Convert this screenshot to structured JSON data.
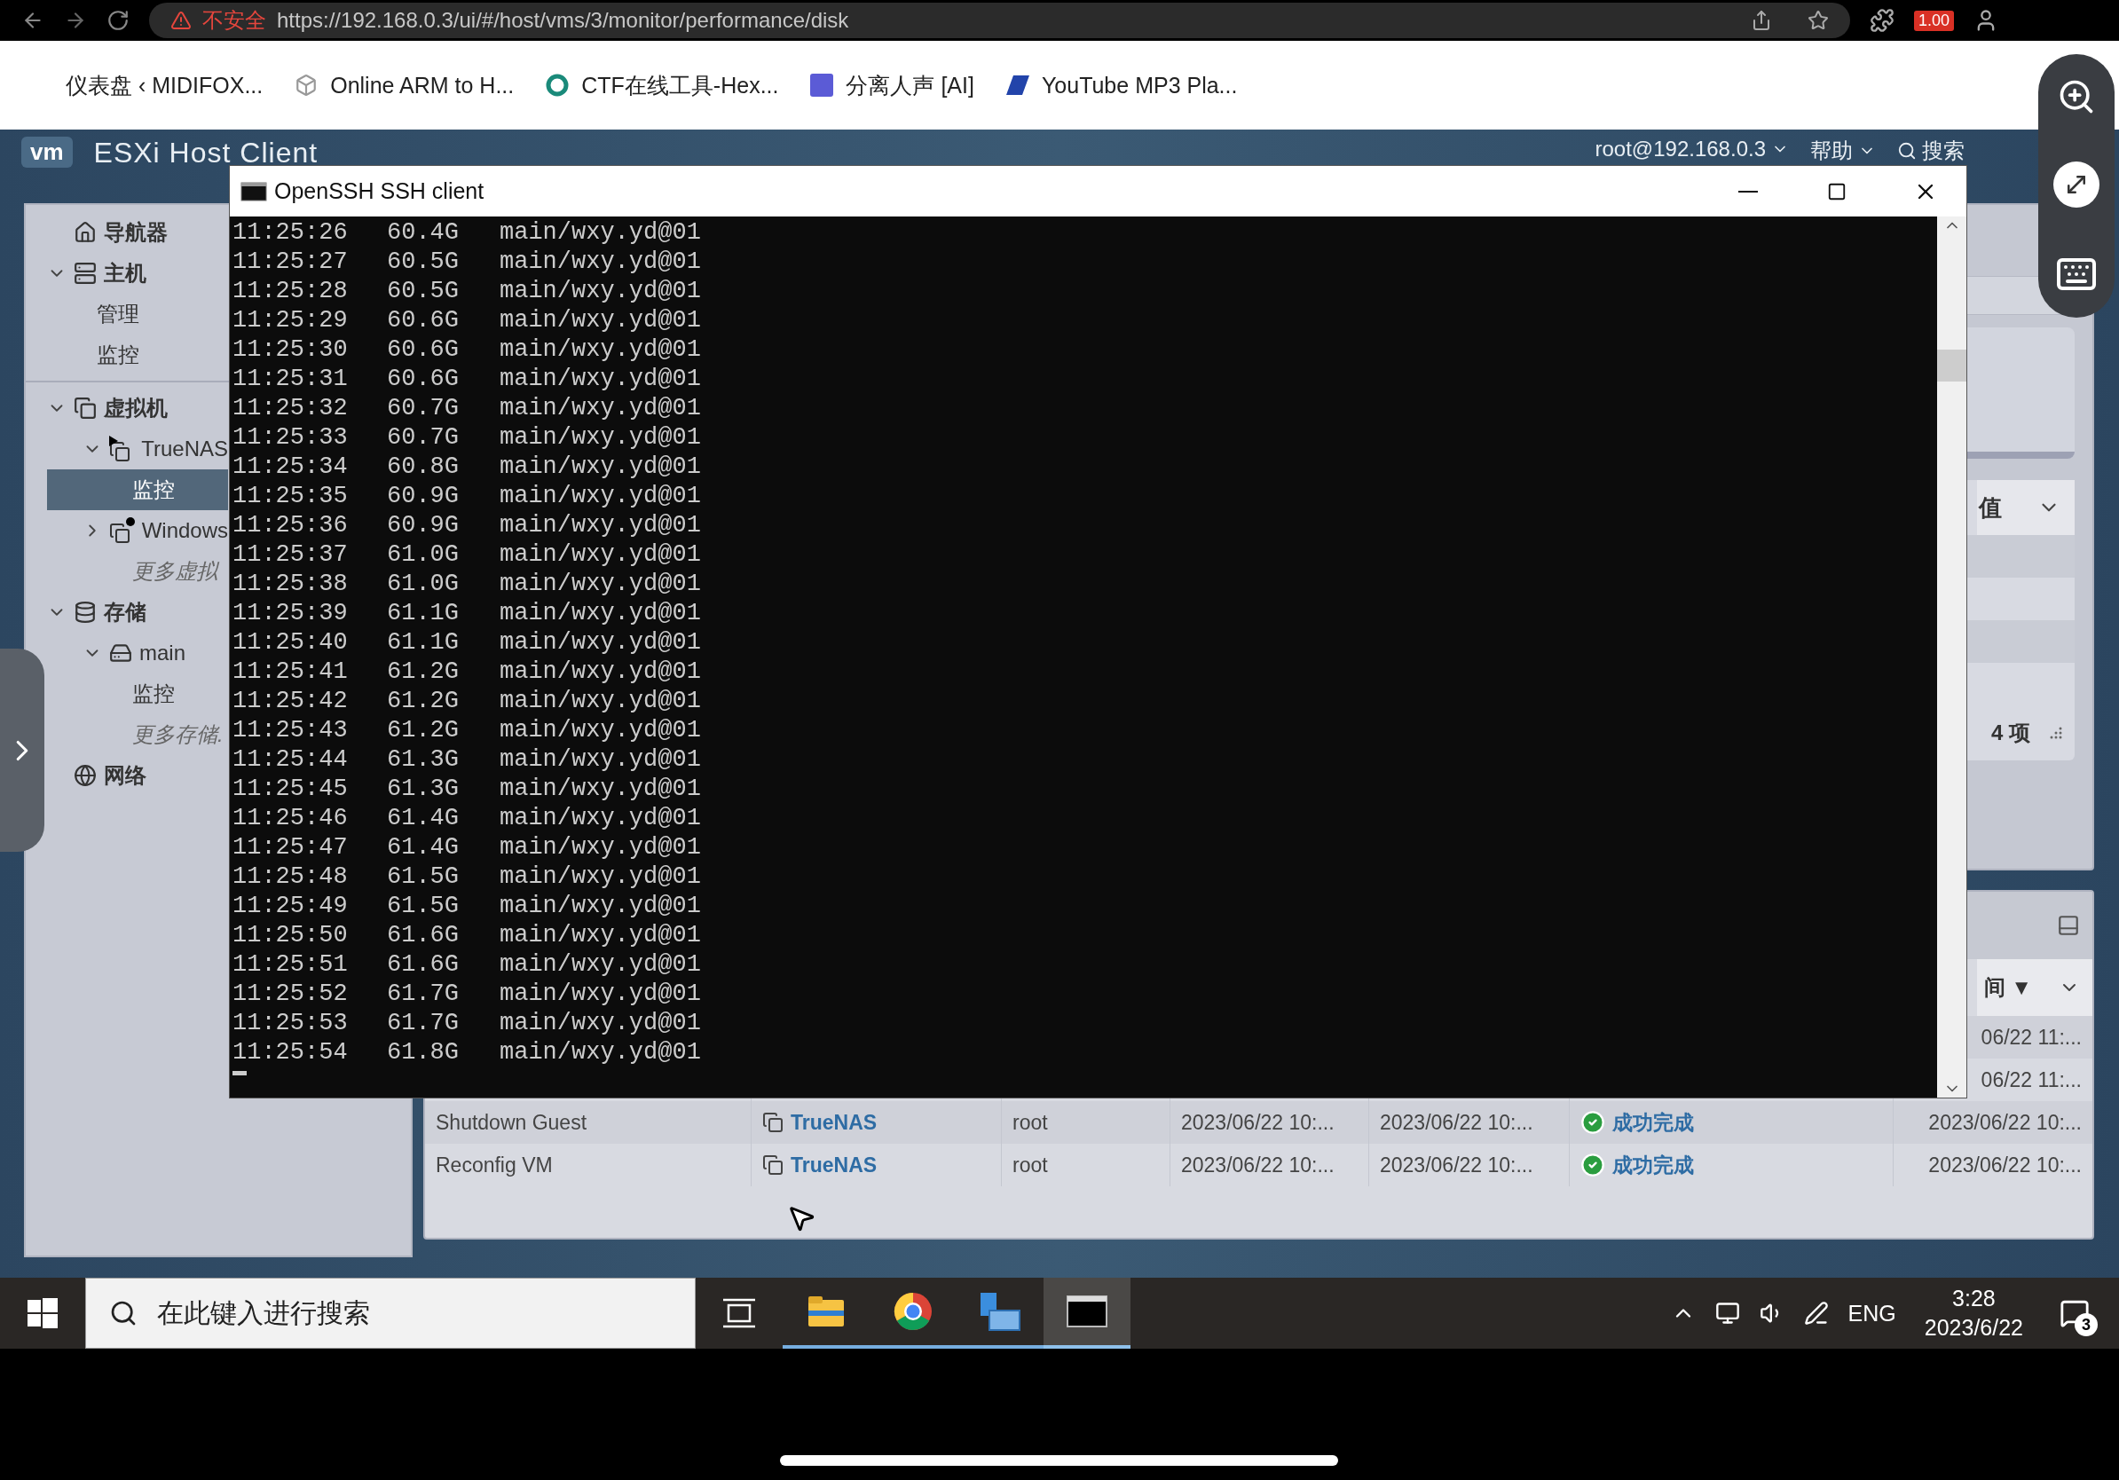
{
  "browser": {
    "security_label": "不安全",
    "url": "https://192.168.0.3/ui/#/host/vms/3/monitor/performance/disk",
    "extension_badge": "1.00"
  },
  "bookmarks": [
    {
      "label": "仪表盘 ‹ MIDIFOX...",
      "kind": "none"
    },
    {
      "label": "Online ARM to H...",
      "kind": "cube"
    },
    {
      "label": "CTF在线工具-Hex...",
      "kind": "ring"
    },
    {
      "label": "分离人声 [AI]",
      "kind": "square"
    },
    {
      "label": "YouTube MP3 Pla...",
      "kind": "slant"
    }
  ],
  "esxi_header": {
    "logo": "vm",
    "title": "ESXi Host Client",
    "user": "root@192.168.0.3",
    "help": "帮助",
    "search": "搜索"
  },
  "navigator": [
    {
      "label": "导航器",
      "kind": "home",
      "selected": false
    },
    {
      "label": "主机",
      "kind": "host",
      "expanded": true,
      "selected": false,
      "children": [
        {
          "label": "管理",
          "kind": "page",
          "selected": false
        },
        {
          "label": "监控",
          "kind": "page",
          "selected": false
        }
      ]
    },
    {
      "label": "虚拟机",
      "kind": "vms",
      "expanded": true,
      "selected": false,
      "children": [
        {
          "label": "TrueNAS",
          "kind": "vm-play",
          "expanded": true,
          "selected": false,
          "children": [
            {
              "label": "监控",
              "kind": "page",
              "selected": true
            }
          ]
        },
        {
          "label": "Windows",
          "kind": "vm-dot",
          "expanded": false,
          "selected": false
        },
        {
          "label": "更多虚拟",
          "kind": "more",
          "selected": false
        }
      ]
    },
    {
      "label": "存储",
      "kind": "storage",
      "expanded": true,
      "selected": false,
      "children": [
        {
          "label": "main",
          "kind": "datastore",
          "expanded": true,
          "selected": false,
          "children": [
            {
              "label": "监控",
              "kind": "page",
              "selected": false
            }
          ]
        },
        {
          "label": "更多存储.",
          "kind": "more",
          "selected": false
        }
      ]
    },
    {
      "label": "网络",
      "kind": "network",
      "selected": false
    }
  ],
  "ssh_window": {
    "title": "OpenSSH SSH client",
    "lines": [
      {
        "time": "11:25:26",
        "size": "60.4G",
        "dataset": "main/wxy.yd@01"
      },
      {
        "time": "11:25:27",
        "size": "60.5G",
        "dataset": "main/wxy.yd@01"
      },
      {
        "time": "11:25:28",
        "size": "60.5G",
        "dataset": "main/wxy.yd@01"
      },
      {
        "time": "11:25:29",
        "size": "60.6G",
        "dataset": "main/wxy.yd@01"
      },
      {
        "time": "11:25:30",
        "size": "60.6G",
        "dataset": "main/wxy.yd@01"
      },
      {
        "time": "11:25:31",
        "size": "60.6G",
        "dataset": "main/wxy.yd@01"
      },
      {
        "time": "11:25:32",
        "size": "60.7G",
        "dataset": "main/wxy.yd@01"
      },
      {
        "time": "11:25:33",
        "size": "60.7G",
        "dataset": "main/wxy.yd@01"
      },
      {
        "time": "11:25:34",
        "size": "60.8G",
        "dataset": "main/wxy.yd@01"
      },
      {
        "time": "11:25:35",
        "size": "60.9G",
        "dataset": "main/wxy.yd@01"
      },
      {
        "time": "11:25:36",
        "size": "60.9G",
        "dataset": "main/wxy.yd@01"
      },
      {
        "time": "11:25:37",
        "size": "61.0G",
        "dataset": "main/wxy.yd@01"
      },
      {
        "time": "11:25:38",
        "size": "61.0G",
        "dataset": "main/wxy.yd@01"
      },
      {
        "time": "11:25:39",
        "size": "61.1G",
        "dataset": "main/wxy.yd@01"
      },
      {
        "time": "11:25:40",
        "size": "61.1G",
        "dataset": "main/wxy.yd@01"
      },
      {
        "time": "11:25:41",
        "size": "61.2G",
        "dataset": "main/wxy.yd@01"
      },
      {
        "time": "11:25:42",
        "size": "61.2G",
        "dataset": "main/wxy.yd@01"
      },
      {
        "time": "11:25:43",
        "size": "61.2G",
        "dataset": "main/wxy.yd@01"
      },
      {
        "time": "11:25:44",
        "size": "61.3G",
        "dataset": "main/wxy.yd@01"
      },
      {
        "time": "11:25:45",
        "size": "61.3G",
        "dataset": "main/wxy.yd@01"
      },
      {
        "time": "11:25:46",
        "size": "61.4G",
        "dataset": "main/wxy.yd@01"
      },
      {
        "time": "11:25:47",
        "size": "61.4G",
        "dataset": "main/wxy.yd@01"
      },
      {
        "time": "11:25:48",
        "size": "61.5G",
        "dataset": "main/wxy.yd@01"
      },
      {
        "time": "11:25:49",
        "size": "61.5G",
        "dataset": "main/wxy.yd@01"
      },
      {
        "time": "11:25:50",
        "size": "61.6G",
        "dataset": "main/wxy.yd@01"
      },
      {
        "time": "11:25:51",
        "size": "61.6G",
        "dataset": "main/wxy.yd@01"
      },
      {
        "time": "11:25:52",
        "size": "61.7G",
        "dataset": "main/wxy.yd@01"
      },
      {
        "time": "11:25:53",
        "size": "61.7G",
        "dataset": "main/wxy.yd@01"
      },
      {
        "time": "11:25:54",
        "size": "61.8G",
        "dataset": "main/wxy.yd@01"
      }
    ]
  },
  "monitor_panel": {
    "dropdown_value": "值",
    "count": "4 项"
  },
  "tasks": {
    "sort_column": "间 ▼",
    "rows": [
      {
        "completed": "06/22 11:..."
      },
      {
        "completed": "06/22 11:..."
      },
      {
        "task": "Shutdown Guest",
        "target": "TrueNAS",
        "initiator": "root",
        "queued": "2023/06/22 10:...",
        "started": "2023/06/22 10:...",
        "result": "成功完成",
        "succeeded": true,
        "completed": "2023/06/22 10:..."
      },
      {
        "task": "Reconfig VM",
        "target": "TrueNAS",
        "initiator": "root",
        "queued": "2023/06/22 10:...",
        "started": "2023/06/22 10:...",
        "result": "成功完成",
        "succeeded": true,
        "completed": "2023/06/22 10:..."
      }
    ]
  },
  "taskbar": {
    "search_placeholder": "在此键入进行搜索",
    "apps": [
      {
        "kind": "explorer",
        "selected": false
      },
      {
        "kind": "browser",
        "selected": false
      },
      {
        "kind": "network-tool",
        "selected": false
      },
      {
        "kind": "terminal",
        "selected": true
      }
    ],
    "language": "ENG",
    "time": "3:28",
    "date": "2023/6/22",
    "notifications": "3"
  }
}
